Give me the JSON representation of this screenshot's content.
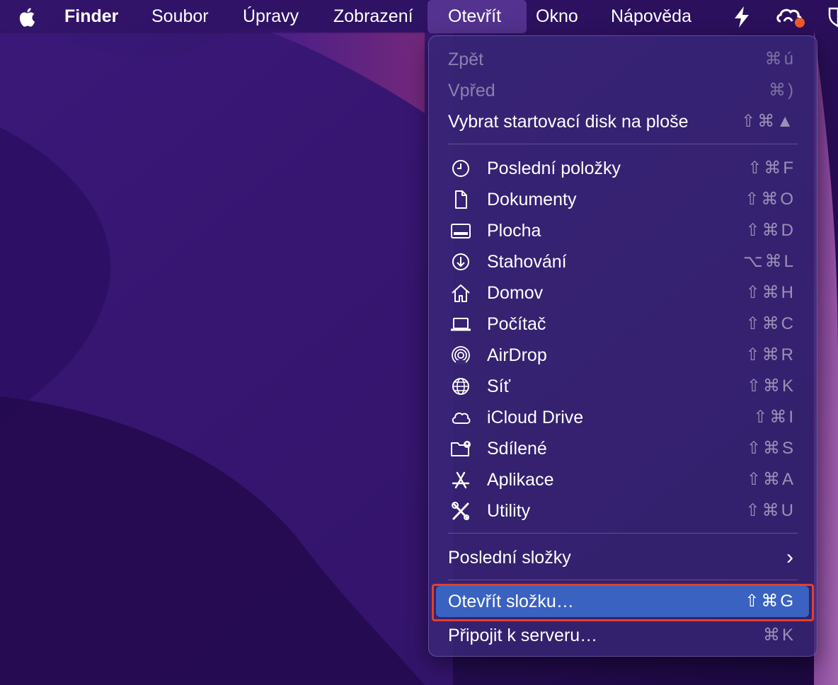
{
  "menubar": {
    "app_name": "Finder",
    "items": [
      "Soubor",
      "Úpravy",
      "Zobrazení",
      "Otevřít",
      "Okno",
      "Nápověda"
    ]
  },
  "menu": {
    "items": [
      {
        "label": "Zpět",
        "shortcut": "⌘ú",
        "disabled": true
      },
      {
        "label": "Vpřed",
        "shortcut": "⌘)",
        "disabled": true
      },
      {
        "label": "Vybrat startovací disk na ploše",
        "shortcut": "⇧⌘▲"
      },
      {
        "label": "Poslední položky",
        "shortcut": "⇧⌘F",
        "icon": "clock-icon"
      },
      {
        "label": "Dokumenty",
        "shortcut": "⇧⌘O",
        "icon": "document-icon"
      },
      {
        "label": "Plocha",
        "shortcut": "⇧⌘D",
        "icon": "desktop-icon"
      },
      {
        "label": "Stahování",
        "shortcut": "⌥⌘L",
        "icon": "download-icon"
      },
      {
        "label": "Domov",
        "shortcut": "⇧⌘H",
        "icon": "home-icon"
      },
      {
        "label": "Počítač",
        "shortcut": "⇧⌘C",
        "icon": "laptop-icon"
      },
      {
        "label": "AirDrop",
        "shortcut": "⇧⌘R",
        "icon": "airdrop-icon"
      },
      {
        "label": "Síť",
        "shortcut": "⇧⌘K",
        "icon": "globe-icon"
      },
      {
        "label": "iCloud Drive",
        "shortcut": "⇧⌘I",
        "icon": "cloud-icon"
      },
      {
        "label": "Sdílené",
        "shortcut": "⇧⌘S",
        "icon": "shared-folder-icon"
      },
      {
        "label": "Aplikace",
        "shortcut": "⇧⌘A",
        "icon": "apps-icon"
      },
      {
        "label": "Utility",
        "shortcut": "⇧⌘U",
        "icon": "utilities-icon"
      },
      {
        "label": "Poslední složky",
        "shortcut": "›"
      },
      {
        "label": "Otevřít složku…",
        "shortcut": "⇧⌘G",
        "highlighted": true
      },
      {
        "label": "Připojit k serveru…",
        "shortcut": "⌘K"
      }
    ]
  },
  "colors": {
    "highlight": "#3a62c0",
    "annotation_box": "#e2402b",
    "status_dot": "#f0582e"
  }
}
